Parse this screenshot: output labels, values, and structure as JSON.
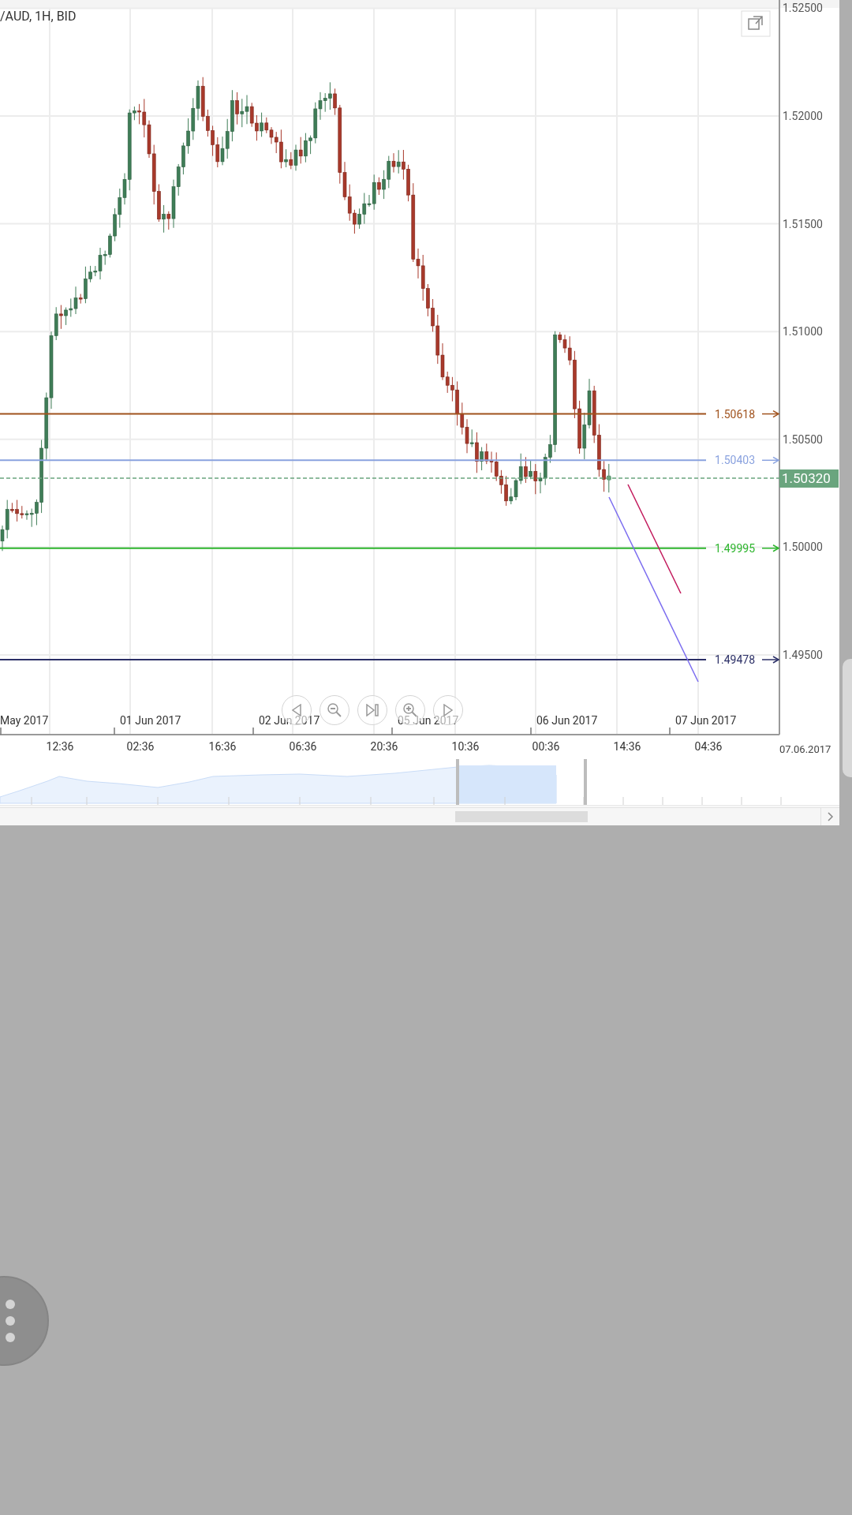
{
  "chart": {
    "title": "/AUD, 1H, BID",
    "y_ticks": [
      "1.52500",
      "1.52000",
      "1.51500",
      "1.51000",
      "1.50500",
      "1.50000",
      "1.49500"
    ],
    "price_levels": [
      {
        "label": "1.50618",
        "color": "#a0521d"
      },
      {
        "label": "1.50403",
        "color": "#8aa2df"
      },
      {
        "label": "1.49995",
        "color": "#2db52d"
      },
      {
        "label": "1.49478",
        "color": "#2b2f66"
      }
    ],
    "current_price": {
      "label": "1.50320",
      "color": "#6aa57e"
    },
    "date_labels": [
      "May 2017",
      "01 Jun 2017",
      "02 Jun 2017",
      "05 Jun 2017",
      "06 Jun 2017",
      "07 Jun 2017"
    ],
    "time_labels": [
      "12:36",
      "02:36",
      "16:36",
      "06:36",
      "20:36",
      "10:36",
      "00:36",
      "14:36",
      "04:36"
    ],
    "end_date": "07.06.2017"
  }
}
